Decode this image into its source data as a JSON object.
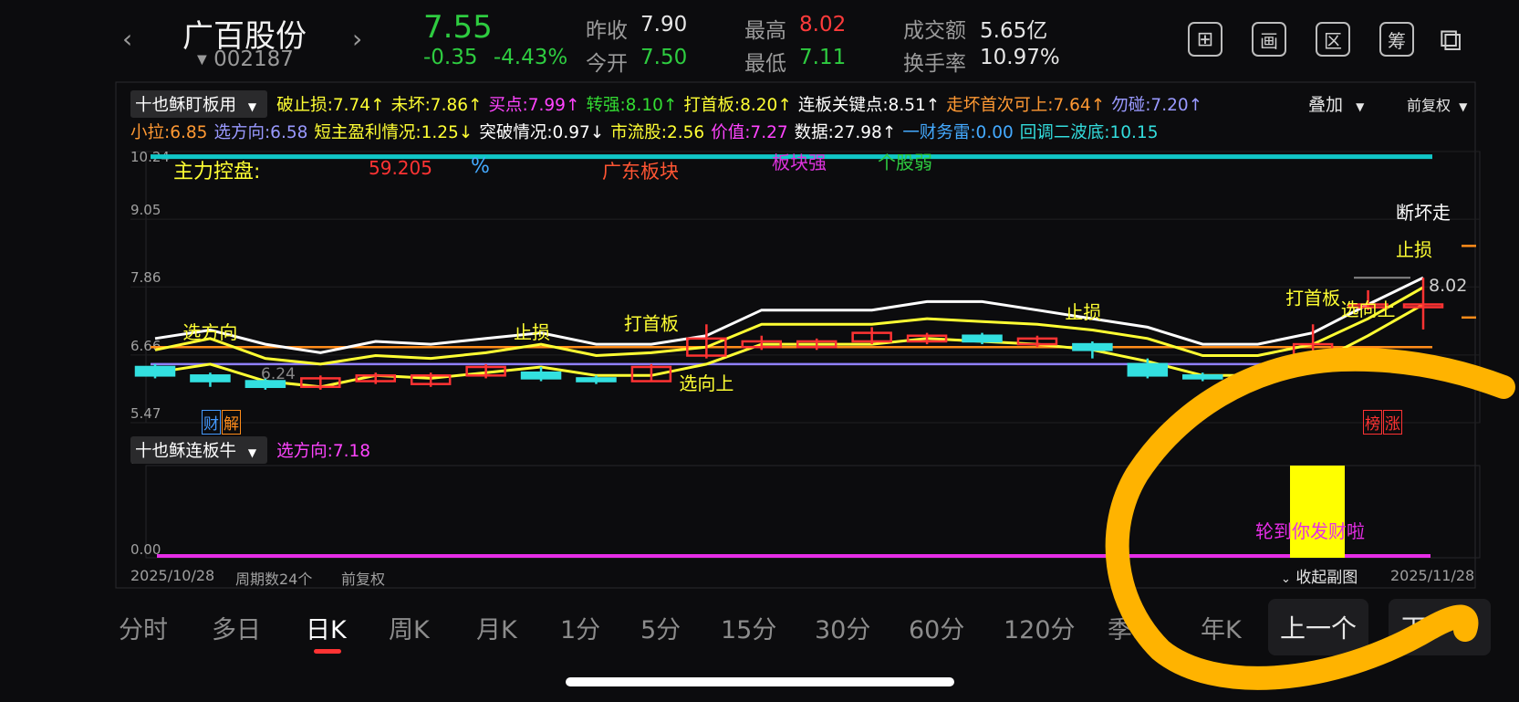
{
  "header": {
    "prev_arrow": "‹",
    "next_arrow": "›",
    "stock_name": "广百股份",
    "stock_code": "002187",
    "price": "7.55",
    "change": "-0.35",
    "change_pct": "-4.43%",
    "prev_close_label": "昨收",
    "prev_close": "7.90",
    "open_label": "今开",
    "open": "7.50",
    "high_label": "最高",
    "high": "8.02",
    "low_label": "最低",
    "low": "7.11",
    "turnover_amt_label": "成交额",
    "turnover_amt": "5.65亿",
    "turnover_rate_label": "换手率",
    "turnover_rate": "10.97%",
    "tools": [
      "⊞",
      "画",
      "区",
      "筹",
      "⧉"
    ]
  },
  "indicator_main": {
    "name": "十也稣盯板用",
    "items": [
      {
        "text": "破止损:7.74↑",
        "color": "#ffff33"
      },
      {
        "text": "未坏:7.86↑",
        "color": "#ffff33"
      },
      {
        "text": "买点:7.99↑",
        "color": "#ff44ff"
      },
      {
        "text": "转强:8.10↑",
        "color": "#33dd33"
      },
      {
        "text": "打首板:8.20↑",
        "color": "#ffff33"
      },
      {
        "text": "连板关键点:8.51↑",
        "color": "#ffffff"
      },
      {
        "text": "走坏首次可上:7.64↑",
        "color": "#ff9933"
      },
      {
        "text": "勿碰:7.20↑",
        "color": "#9999ff"
      }
    ],
    "overlay_label": "叠加",
    "adjust_label": "前复权",
    "items_row2": [
      {
        "text": "小拉:6.85",
        "color": "#ff9933"
      },
      {
        "text": "选方向:6.58",
        "color": "#9999ff"
      },
      {
        "text": "短主盈利情况:1.25↓",
        "color": "#ffff33"
      },
      {
        "text": "突破情况:0.97↓",
        "color": "#ffffff"
      },
      {
        "text": "市流股:2.56",
        "color": "#ffff33"
      },
      {
        "text": "价值:7.27",
        "color": "#ff44ff"
      },
      {
        "text": "数据:27.98↑",
        "color": "#ffffff"
      },
      {
        "text": "一财务雷:0.00",
        "color": "#44aaff"
      },
      {
        "text": "回调二波底:10.15",
        "color": "#33dddd"
      }
    ]
  },
  "main_overlay_text": {
    "t1": "主力控盘:",
    "t2": "59.205",
    "t3": "%",
    "t4": "广东板块",
    "t5": "板块强",
    "t6": "个股弱",
    "badge_cai": "财",
    "badge_jie": "解",
    "badge_bang": "榜",
    "badge_zhang": "涨",
    "max_marker": "8.02",
    "min_marker": "6.24"
  },
  "indicator_sub": {
    "name": "十也稣连板牛",
    "items": [
      {
        "text": "选方向:7.18",
        "color": "#ff44ff"
      }
    ],
    "slogan": "轮到你发财啦",
    "collapse_label": "收起副图"
  },
  "footer_axis": {
    "start_date": "2025/10/28",
    "period_count": "周期数24个",
    "adjust": "前复权",
    "end_date": "2025/11/28"
  },
  "tabs": [
    {
      "label": "分时",
      "active": false
    },
    {
      "label": "多日",
      "active": false
    },
    {
      "label": "日K",
      "active": true
    },
    {
      "label": "周K",
      "active": false
    },
    {
      "label": "月K",
      "active": false
    },
    {
      "label": "1分",
      "active": false
    },
    {
      "label": "5分",
      "active": false
    },
    {
      "label": "15分",
      "active": false
    },
    {
      "label": "30分",
      "active": false
    },
    {
      "label": "60分",
      "active": false
    },
    {
      "label": "120分",
      "active": false
    },
    {
      "label": "季K",
      "active": false
    },
    {
      "label": "年K",
      "active": false
    }
  ],
  "nav": {
    "prev": "上一个",
    "next": "下一个"
  },
  "colors": {
    "up": "#ff3333",
    "down": "#33e0e0",
    "green_text": "#2ecc40",
    "red_text": "#ff3b3b",
    "yellow": "#ffff33",
    "white_line": "#ffffff",
    "orange_line": "#ff8c1a",
    "purple_line": "#9080ff",
    "cyan_line": "#11c8c8",
    "magenta": "#e62de6",
    "annotation": "#ffb300"
  },
  "chart_data": {
    "type": "candlestick",
    "start_date": "2025/10/28",
    "end_date": "2025/11/28",
    "ylim": [
      5.47,
      10.24
    ],
    "y_ticks": [
      10.24,
      9.05,
      7.86,
      6.66,
      5.47
    ],
    "candles": [
      {
        "o": 6.45,
        "c": 6.3,
        "h": 6.5,
        "l": 6.25
      },
      {
        "o": 6.3,
        "c": 6.2,
        "h": 6.35,
        "l": 6.1
      },
      {
        "o": 6.2,
        "c": 6.1,
        "h": 6.25,
        "l": 6.05
      },
      {
        "o": 6.1,
        "c": 6.25,
        "h": 6.3,
        "l": 6.05
      },
      {
        "o": 6.2,
        "c": 6.3,
        "h": 6.35,
        "l": 6.15
      },
      {
        "o": 6.15,
        "c": 6.3,
        "h": 6.35,
        "l": 6.1
      },
      {
        "o": 6.3,
        "c": 6.45,
        "h": 6.5,
        "l": 6.25
      },
      {
        "o": 6.35,
        "c": 6.25,
        "h": 6.45,
        "l": 6.2
      },
      {
        "o": 6.25,
        "c": 6.2,
        "h": 6.3,
        "l": 6.15
      },
      {
        "o": 6.2,
        "c": 6.45,
        "h": 6.5,
        "l": 6.2
      },
      {
        "o": 6.65,
        "c": 6.95,
        "h": 7.2,
        "l": 6.6
      },
      {
        "o": 6.8,
        "c": 6.9,
        "h": 7.0,
        "l": 6.75
      },
      {
        "o": 6.8,
        "c": 6.9,
        "h": 6.95,
        "l": 6.75
      },
      {
        "o": 6.9,
        "c": 7.05,
        "h": 7.15,
        "l": 6.85
      },
      {
        "o": 6.9,
        "c": 7.0,
        "h": 7.05,
        "l": 6.85
      },
      {
        "o": 7.0,
        "c": 6.9,
        "h": 7.05,
        "l": 6.85
      },
      {
        "o": 6.85,
        "c": 6.95,
        "h": 7.0,
        "l": 6.8
      },
      {
        "o": 6.85,
        "c": 6.75,
        "h": 6.9,
        "l": 6.6
      },
      {
        "o": 6.5,
        "c": 6.3,
        "h": 6.6,
        "l": 6.25
      },
      {
        "o": 6.3,
        "c": 6.25,
        "h": 6.35,
        "l": 6.2
      },
      {
        "o": 6.2,
        "c": 6.3,
        "h": 6.3,
        "l": 6.15
      },
      {
        "o": 6.65,
        "c": 6.85,
        "h": 7.2,
        "l": 6.6
      },
      {
        "o": 7.5,
        "c": 7.55,
        "h": 7.8,
        "l": 7.45
      },
      {
        "o": 7.55,
        "c": 7.55,
        "h": 8.02,
        "l": 7.11
      }
    ],
    "series": [
      {
        "values": [
          6.95,
          7.1,
          6.85,
          6.7,
          6.9,
          6.85,
          6.95,
          7.05,
          6.85,
          6.85,
          7.0,
          7.45,
          7.45,
          7.45,
          7.6,
          7.6,
          7.45,
          7.3,
          7.15,
          6.85,
          6.85,
          7.05,
          7.55,
          8.02
        ]
      },
      {
        "values": [
          6.75,
          6.95,
          6.6,
          6.5,
          6.65,
          6.6,
          6.7,
          6.85,
          6.65,
          6.7,
          6.8,
          7.2,
          7.2,
          7.2,
          7.3,
          7.25,
          7.2,
          7.1,
          6.95,
          6.65,
          6.65,
          6.85,
          7.3,
          7.85
        ]
      },
      {
        "values": [
          6.35,
          6.5,
          6.2,
          6.1,
          6.3,
          6.25,
          6.35,
          6.45,
          6.3,
          6.3,
          6.5,
          6.85,
          6.85,
          6.85,
          6.95,
          6.9,
          6.85,
          6.75,
          6.55,
          6.3,
          6.3,
          6.5,
          7.0,
          7.55
        ]
      }
    ],
    "hlines": [
      {
        "y": 6.8,
        "color": "#ff8c1a"
      },
      {
        "y": 6.5,
        "color": "#9080ff"
      },
      {
        "y": 10.15,
        "color": "#11c8c8"
      }
    ],
    "annotations": [
      {
        "text": "选方向",
        "i": 1,
        "y": 6.95,
        "color": "#ffff33"
      },
      {
        "text": "止损",
        "i": 7,
        "y": 6.95,
        "color": "#ffff33"
      },
      {
        "text": "打首板",
        "i": 9,
        "y": 7.1,
        "color": "#ffff33"
      },
      {
        "text": "选向上",
        "i": 10,
        "y": 6.05,
        "color": "#ffff33"
      },
      {
        "text": "止损",
        "i": 17,
        "y": 7.3,
        "color": "#ffff33"
      },
      {
        "text": "打首板",
        "i": 21,
        "y": 7.55,
        "color": "#ffff33"
      },
      {
        "text": "选向上",
        "i": 22,
        "y": 7.35,
        "color": "#ffff33"
      },
      {
        "text": "止损",
        "i": 23,
        "y": 8.4,
        "color": "#ffff33"
      },
      {
        "text": "断坏走",
        "i": 23,
        "y": 9.05,
        "color": "#ffffff"
      }
    ],
    "sub_chart": {
      "ylim": [
        0,
        150
      ],
      "y_ticks": [
        150.0,
        0.0
      ],
      "bars": [
        {
          "i": 21,
          "value": 150
        }
      ]
    }
  }
}
